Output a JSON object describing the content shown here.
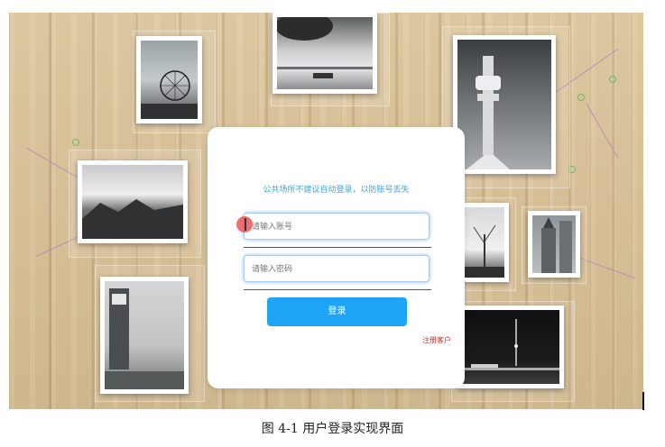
{
  "login": {
    "notice": "公共场所不建议自动登录，以防账号丢失",
    "username_placeholder": "请输入账号",
    "password_placeholder": "请输入密码",
    "login_button": "登录",
    "register_link": "注册客户"
  },
  "caption": "图 4-1 用户登录实现界面",
  "colors": {
    "accent": "#1ea5f5",
    "notice": "#3aa5de",
    "register": "#c0392b"
  }
}
